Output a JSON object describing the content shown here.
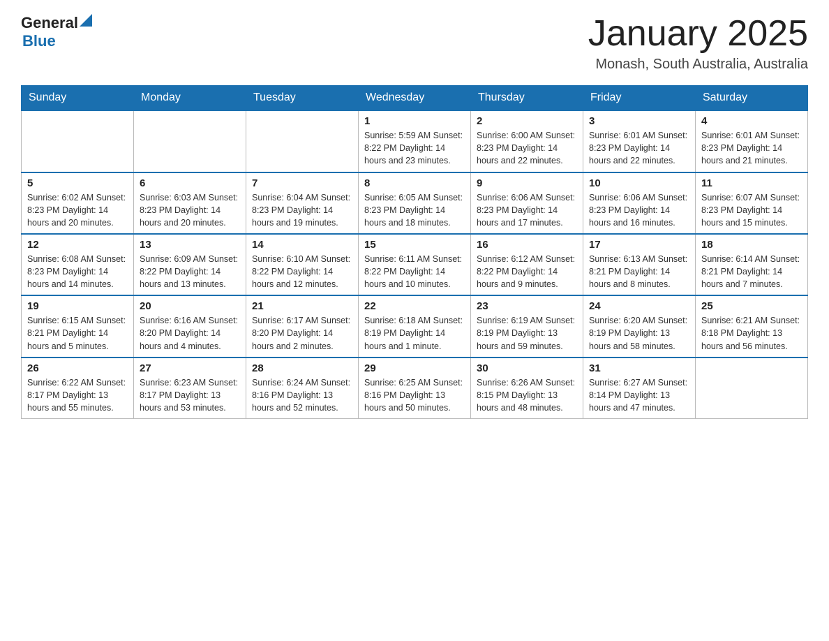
{
  "header": {
    "logo_general": "General",
    "logo_blue": "Blue",
    "title": "January 2025",
    "subtitle": "Monash, South Australia, Australia"
  },
  "days_of_week": [
    "Sunday",
    "Monday",
    "Tuesday",
    "Wednesday",
    "Thursday",
    "Friday",
    "Saturday"
  ],
  "weeks": [
    [
      {
        "day": "",
        "info": ""
      },
      {
        "day": "",
        "info": ""
      },
      {
        "day": "",
        "info": ""
      },
      {
        "day": "1",
        "info": "Sunrise: 5:59 AM\nSunset: 8:22 PM\nDaylight: 14 hours\nand 23 minutes."
      },
      {
        "day": "2",
        "info": "Sunrise: 6:00 AM\nSunset: 8:23 PM\nDaylight: 14 hours\nand 22 minutes."
      },
      {
        "day": "3",
        "info": "Sunrise: 6:01 AM\nSunset: 8:23 PM\nDaylight: 14 hours\nand 22 minutes."
      },
      {
        "day": "4",
        "info": "Sunrise: 6:01 AM\nSunset: 8:23 PM\nDaylight: 14 hours\nand 21 minutes."
      }
    ],
    [
      {
        "day": "5",
        "info": "Sunrise: 6:02 AM\nSunset: 8:23 PM\nDaylight: 14 hours\nand 20 minutes."
      },
      {
        "day": "6",
        "info": "Sunrise: 6:03 AM\nSunset: 8:23 PM\nDaylight: 14 hours\nand 20 minutes."
      },
      {
        "day": "7",
        "info": "Sunrise: 6:04 AM\nSunset: 8:23 PM\nDaylight: 14 hours\nand 19 minutes."
      },
      {
        "day": "8",
        "info": "Sunrise: 6:05 AM\nSunset: 8:23 PM\nDaylight: 14 hours\nand 18 minutes."
      },
      {
        "day": "9",
        "info": "Sunrise: 6:06 AM\nSunset: 8:23 PM\nDaylight: 14 hours\nand 17 minutes."
      },
      {
        "day": "10",
        "info": "Sunrise: 6:06 AM\nSunset: 8:23 PM\nDaylight: 14 hours\nand 16 minutes."
      },
      {
        "day": "11",
        "info": "Sunrise: 6:07 AM\nSunset: 8:23 PM\nDaylight: 14 hours\nand 15 minutes."
      }
    ],
    [
      {
        "day": "12",
        "info": "Sunrise: 6:08 AM\nSunset: 8:23 PM\nDaylight: 14 hours\nand 14 minutes."
      },
      {
        "day": "13",
        "info": "Sunrise: 6:09 AM\nSunset: 8:22 PM\nDaylight: 14 hours\nand 13 minutes."
      },
      {
        "day": "14",
        "info": "Sunrise: 6:10 AM\nSunset: 8:22 PM\nDaylight: 14 hours\nand 12 minutes."
      },
      {
        "day": "15",
        "info": "Sunrise: 6:11 AM\nSunset: 8:22 PM\nDaylight: 14 hours\nand 10 minutes."
      },
      {
        "day": "16",
        "info": "Sunrise: 6:12 AM\nSunset: 8:22 PM\nDaylight: 14 hours\nand 9 minutes."
      },
      {
        "day": "17",
        "info": "Sunrise: 6:13 AM\nSunset: 8:21 PM\nDaylight: 14 hours\nand 8 minutes."
      },
      {
        "day": "18",
        "info": "Sunrise: 6:14 AM\nSunset: 8:21 PM\nDaylight: 14 hours\nand 7 minutes."
      }
    ],
    [
      {
        "day": "19",
        "info": "Sunrise: 6:15 AM\nSunset: 8:21 PM\nDaylight: 14 hours\nand 5 minutes."
      },
      {
        "day": "20",
        "info": "Sunrise: 6:16 AM\nSunset: 8:20 PM\nDaylight: 14 hours\nand 4 minutes."
      },
      {
        "day": "21",
        "info": "Sunrise: 6:17 AM\nSunset: 8:20 PM\nDaylight: 14 hours\nand 2 minutes."
      },
      {
        "day": "22",
        "info": "Sunrise: 6:18 AM\nSunset: 8:19 PM\nDaylight: 14 hours\nand 1 minute."
      },
      {
        "day": "23",
        "info": "Sunrise: 6:19 AM\nSunset: 8:19 PM\nDaylight: 13 hours\nand 59 minutes."
      },
      {
        "day": "24",
        "info": "Sunrise: 6:20 AM\nSunset: 8:19 PM\nDaylight: 13 hours\nand 58 minutes."
      },
      {
        "day": "25",
        "info": "Sunrise: 6:21 AM\nSunset: 8:18 PM\nDaylight: 13 hours\nand 56 minutes."
      }
    ],
    [
      {
        "day": "26",
        "info": "Sunrise: 6:22 AM\nSunset: 8:17 PM\nDaylight: 13 hours\nand 55 minutes."
      },
      {
        "day": "27",
        "info": "Sunrise: 6:23 AM\nSunset: 8:17 PM\nDaylight: 13 hours\nand 53 minutes."
      },
      {
        "day": "28",
        "info": "Sunrise: 6:24 AM\nSunset: 8:16 PM\nDaylight: 13 hours\nand 52 minutes."
      },
      {
        "day": "29",
        "info": "Sunrise: 6:25 AM\nSunset: 8:16 PM\nDaylight: 13 hours\nand 50 minutes."
      },
      {
        "day": "30",
        "info": "Sunrise: 6:26 AM\nSunset: 8:15 PM\nDaylight: 13 hours\nand 48 minutes."
      },
      {
        "day": "31",
        "info": "Sunrise: 6:27 AM\nSunset: 8:14 PM\nDaylight: 13 hours\nand 47 minutes."
      },
      {
        "day": "",
        "info": ""
      }
    ]
  ]
}
